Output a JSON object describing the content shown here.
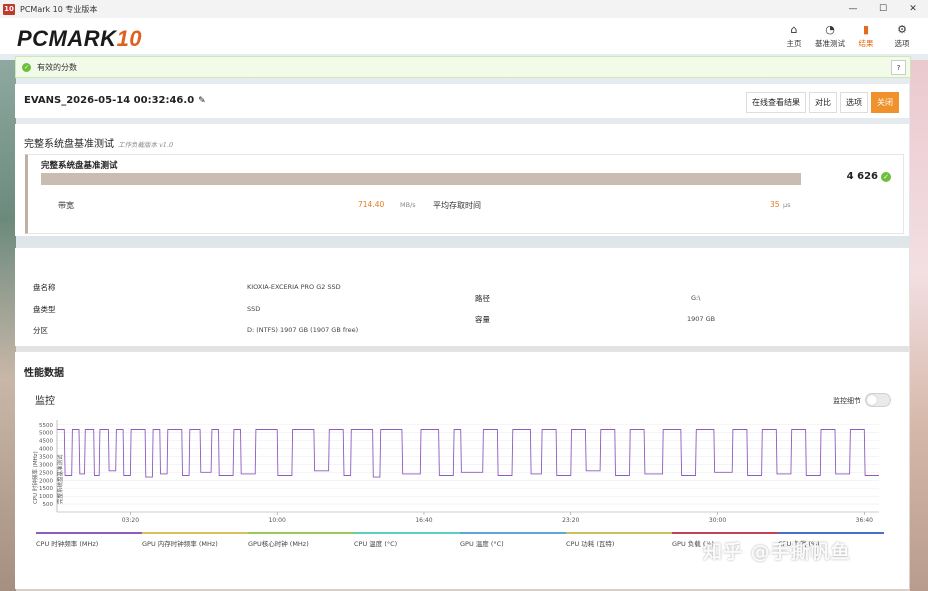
{
  "window": {
    "app_icon_text": "10",
    "title": "PCMark 10 专业版本"
  },
  "header": {
    "logo_main": "PCMARK",
    "logo_ten": "10",
    "nav": [
      {
        "label": "主页",
        "icon": "home-icon",
        "glyph": "⌂"
      },
      {
        "label": "基准测试",
        "icon": "gauge-icon",
        "glyph": "◔"
      },
      {
        "label": "结果",
        "icon": "bar-chart-icon",
        "glyph": "▮"
      },
      {
        "label": "选项",
        "icon": "gear-icon",
        "glyph": "⚙"
      }
    ],
    "active_nav": "结果"
  },
  "valid_bar": {
    "text": "有效的分数",
    "help": "?"
  },
  "result": {
    "name": "EVANS_2026-05-14 00:32:46.0",
    "buttons": [
      "在线查看结果",
      "对比",
      "选项",
      "关闭"
    ]
  },
  "score_panel": {
    "title": "完整系统盘基准测试",
    "subtitle": "工作负载版本 v1.0",
    "test_name": "完整系统盘基准测试",
    "score": "4 626",
    "metric1_label": "带宽",
    "metric1_value": "714.40",
    "metric1_unit": "MB/s",
    "metric2_label": "平均存取时间",
    "metric2_value": "35",
    "metric2_unit": "µs"
  },
  "drive_info": {
    "name_label": "盘名称",
    "name_value": "KIOXIA-EXCERIA PRO G2 SSD",
    "type_label": "盘类型",
    "type_value": "SSD",
    "part_label": "分区",
    "part_value": "D: (NTFS) 1907 GB (1907 GB free)",
    "path_label": "路径",
    "path_value": "G:\\",
    "cap_label": "容量",
    "cap_value": "1907 GB"
  },
  "perf": {
    "title": "性能数据",
    "monitor_title": "监控",
    "toggle_label": "监控细节",
    "y_axis_label": "CPU 时钟频率 (MHz)",
    "y_axis_label2": "完整系统盘基准测试",
    "legend": [
      {
        "label": "CPU 时钟频率 (MHz)",
        "color": "#8e5bbf"
      },
      {
        "label": "GPU 内存时钟频率 (MHz)",
        "color": "#d4c15a"
      },
      {
        "label": "GPU核心时钟 (MHz)",
        "color": "#9ac85a"
      },
      {
        "label": "CPU 温度 (°C)",
        "color": "#5ccfbf"
      },
      {
        "label": "GPU 温度 (°C)",
        "color": "#5aa9d8"
      },
      {
        "label": "CPU 功耗 (瓦特)",
        "color": "#c8c05a"
      },
      {
        "label": "GPU 负载 (%)",
        "color": "#c0435a"
      },
      {
        "label": "CPU 负载 (%)",
        "color": "#4a6fc8"
      }
    ]
  },
  "watermark": "知乎 @手撕帆鱼",
  "chart_data": {
    "type": "line",
    "title": "",
    "xlabel": "",
    "ylabel": "CPU 时钟频率 (MHz)",
    "x_ticks": [
      "03:20",
      "10:00",
      "16:40",
      "23:20",
      "30:00",
      "36:40"
    ],
    "y_ticks": [
      500,
      1000,
      1500,
      2000,
      2500,
      3000,
      3500,
      4000,
      4500,
      5000,
      5500
    ],
    "ylim": [
      0,
      5800
    ],
    "xlim_seconds": [
      0,
      2240
    ],
    "series": [
      {
        "name": "CPU 时钟频率 (MHz)",
        "color": "#8e5bbf",
        "high_value": 5200,
        "low_value": 2300,
        "x_seconds": [
          0,
          20,
          22,
          40,
          42,
          60,
          62,
          75,
          77,
          100,
          102,
          115,
          117,
          140,
          142,
          160,
          162,
          180,
          182,
          200,
          202,
          240,
          242,
          260,
          262,
          280,
          282,
          300,
          302,
          340,
          342,
          360,
          362,
          390,
          392,
          420,
          422,
          440,
          442,
          480,
          482,
          500,
          502,
          540,
          542,
          600,
          602,
          640,
          642,
          700,
          702,
          740,
          742,
          780,
          782,
          800,
          802,
          860,
          862,
          880,
          882,
          940,
          942,
          990,
          992,
          1040,
          1042,
          1080,
          1082,
          1100,
          1102,
          1160,
          1162,
          1200,
          1202,
          1240,
          1242,
          1290,
          1292,
          1320,
          1322,
          1360,
          1362,
          1400,
          1402,
          1440,
          1442,
          1480,
          1482,
          1520,
          1522,
          1560,
          1562,
          1600,
          1602,
          1650,
          1652,
          1700,
          1702,
          1740,
          1742,
          1790,
          1792,
          1840,
          1842,
          1880,
          1882,
          1920,
          1922,
          1960,
          1962,
          2000,
          2002,
          2040,
          2042,
          2080,
          2082,
          2120,
          2122,
          2160,
          2162,
          2200,
          2202,
          2240
        ],
        "values": [
          5200,
          5200,
          2300,
          2300,
          5200,
          5200,
          2400,
          2400,
          5200,
          5200,
          2300,
          2300,
          5200,
          5200,
          2600,
          2600,
          5200,
          5200,
          2300,
          2300,
          5200,
          5200,
          2200,
          2200,
          5200,
          5200,
          2400,
          2400,
          5200,
          5200,
          2300,
          2300,
          5200,
          5200,
          2500,
          2500,
          5200,
          5200,
          2300,
          2300,
          5200,
          5200,
          2400,
          2400,
          5200,
          5200,
          2300,
          2300,
          5200,
          5200,
          2600,
          2600,
          5200,
          5200,
          2300,
          2300,
          5200,
          5200,
          2200,
          2200,
          5200,
          5200,
          2400,
          2400,
          5200,
          5200,
          2300,
          2300,
          5200,
          5200,
          2500,
          2500,
          5200,
          5200,
          2300,
          2300,
          5200,
          5200,
          2400,
          2400,
          5200,
          5200,
          2300,
          2300,
          5200,
          5200,
          2600,
          2600,
          5200,
          5200,
          2300,
          2300,
          5200,
          5200,
          2400,
          2400,
          5200,
          5200,
          2300,
          2300,
          5200,
          5200,
          2500,
          2500,
          5200,
          5200,
          2300,
          2300,
          5200,
          5200,
          2400,
          2400,
          5200,
          5200,
          2300,
          2300,
          5200,
          5200,
          2400,
          2400,
          5200,
          5200,
          2300,
          2300,
          5200,
          5200
        ]
      }
    ],
    "grid": true,
    "legend_position": "bottom"
  }
}
